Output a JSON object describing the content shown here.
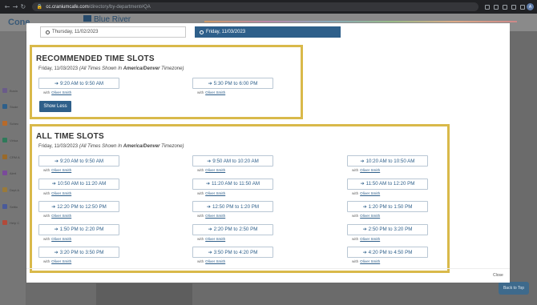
{
  "browser": {
    "url_host": "cc.craniumcafe.com",
    "url_path": "/directory/by-department#QA",
    "profile_initial": "A"
  },
  "background": {
    "logo": "Cone",
    "brand": "Blue River",
    "sidebar_items": [
      "Busin",
      "Stude",
      "Schec",
      "Virtua",
      "CRM A",
      "Alert",
      "Dept A",
      "Settin",
      "Help C"
    ],
    "back_to_top": "Back to Top"
  },
  "modal": {
    "dates": {
      "inactive": "Thursday, 11/02/2023",
      "active": "Friday, 11/03/2023"
    },
    "recommended": {
      "title": "RECOMMENDED TIME SLOTS",
      "date": "Friday, 11/03/2023",
      "tz_prefix": "(All Times Shown In ",
      "tz_name": "America/Denver",
      "tz_suffix": " Timezone)",
      "slots": [
        {
          "time": "9:20 AM to 9:50 AM",
          "with_label": "with",
          "person": "Oliver Smith"
        },
        {
          "time": "5:30 PM to 6:00 PM",
          "with_label": "with",
          "person": "Oliver Smith"
        }
      ],
      "show_less": "Show Less"
    },
    "all": {
      "title": "ALL TIME SLOTS",
      "date": "Friday, 11/03/2023",
      "tz_prefix": "(All Times Shown In ",
      "tz_name": "America/Denver",
      "tz_suffix": " Timezone)",
      "slots": [
        {
          "time": "9:20 AM to 9:50 AM",
          "person": "Oliver Smith"
        },
        {
          "time": "9:50 AM to 10:20 AM",
          "person": "Oliver Smith"
        },
        {
          "time": "10:20 AM to 10:50 AM",
          "person": "Oliver Smith"
        },
        {
          "time": "10:50 AM to 11:20 AM",
          "person": "Oliver Smith"
        },
        {
          "time": "11:20 AM to 11:50 AM",
          "person": "Oliver Smith"
        },
        {
          "time": "11:50 AM to 12:20 PM",
          "person": "Oliver Smith"
        },
        {
          "time": "12:20 PM to 12:50 PM",
          "person": "Oliver Smith"
        },
        {
          "time": "12:50 PM to 1:20 PM",
          "person": "Oliver Smith"
        },
        {
          "time": "1:20 PM to 1:50 PM",
          "person": "Oliver Smith"
        },
        {
          "time": "1:50 PM to 2:20 PM",
          "person": "Oliver Smith"
        },
        {
          "time": "2:20 PM to 2:50 PM",
          "person": "Oliver Smith"
        },
        {
          "time": "2:50 PM to 3:20 PM",
          "person": "Oliver Smith"
        },
        {
          "time": "3:20 PM to 3:50 PM",
          "person": "Oliver Smith"
        },
        {
          "time": "3:50 PM to 4:20 PM",
          "person": "Oliver Smith"
        },
        {
          "time": "4:20 PM to 4:50 PM",
          "person": "Oliver Smith"
        }
      ]
    },
    "with_label": "with",
    "close": "Close"
  },
  "colors": {
    "accent": "#2e5f8a",
    "highlight_border": "#d9b94a"
  }
}
